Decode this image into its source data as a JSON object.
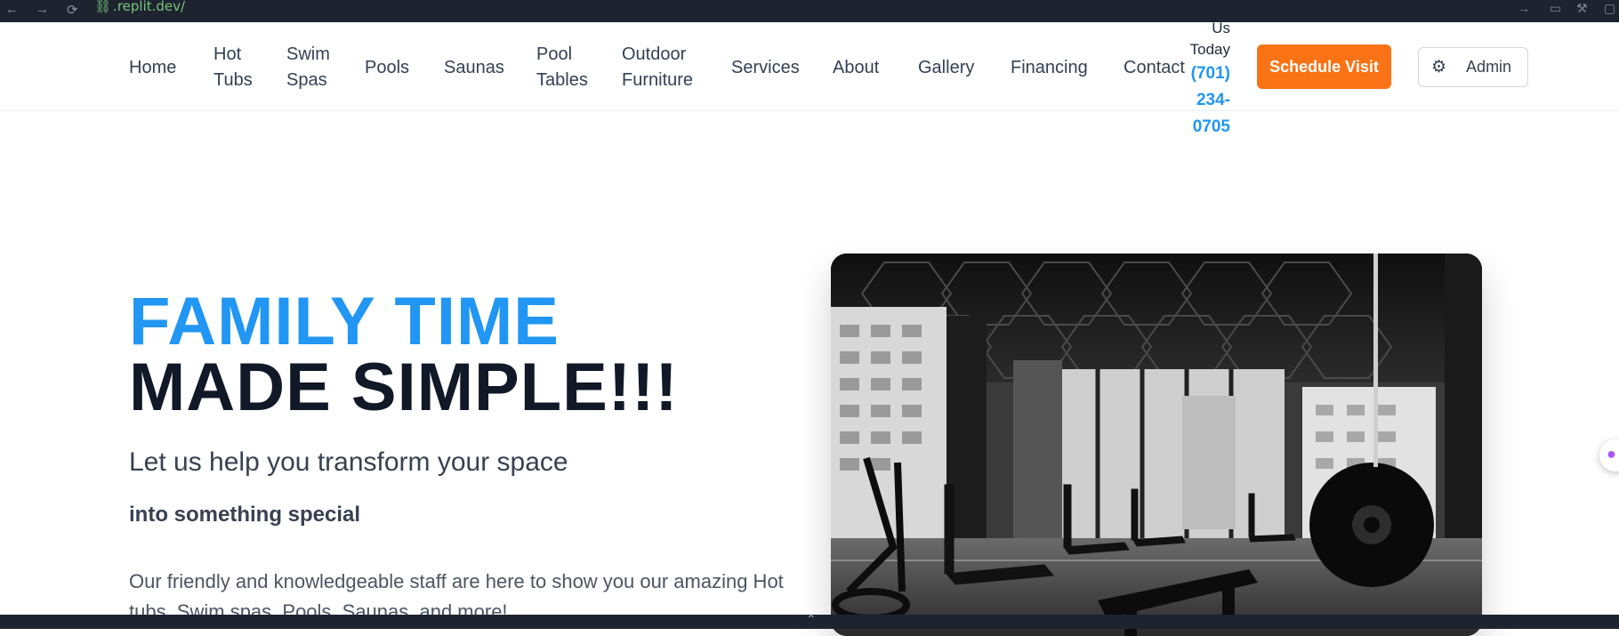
{
  "browser": {
    "url": ".replit.dev/",
    "back_icon": "←",
    "forward_icon": "→",
    "reload_icon": "⟳",
    "link_icon": "🔗"
  },
  "nav": {
    "links": [
      {
        "id": "home",
        "label": "Home"
      },
      {
        "id": "hot-tubs",
        "label_lines": [
          "Hot",
          "Tubs"
        ]
      },
      {
        "id": "swim-spas",
        "label_lines": [
          "Swim",
          "Spas"
        ]
      },
      {
        "id": "pools",
        "label": "Pools"
      },
      {
        "id": "saunas",
        "label": "Saunas"
      },
      {
        "id": "pool-tables",
        "label_lines": [
          "Pool",
          "Tables"
        ]
      },
      {
        "id": "outdoor-furniture",
        "label_lines": [
          "Outdoor",
          "Furniture"
        ]
      },
      {
        "id": "services",
        "label": "Services"
      },
      {
        "id": "about",
        "label": "About"
      },
      {
        "id": "gallery",
        "label": "Gallery"
      },
      {
        "id": "financing",
        "label": "Financing"
      },
      {
        "id": "contact",
        "label": "Contact"
      }
    ],
    "call_lines": [
      "Us",
      "Today"
    ],
    "phone_lines": [
      "(701)",
      "234-",
      "0705"
    ],
    "schedule_label": "Schedule Visit",
    "admin_label": "Admin"
  },
  "hero": {
    "title_line1": "FAMILY TIME",
    "title_line2": "MADE SIMPLE!!!",
    "subtitle": "Let us help you transform your space",
    "subtitle2": "into something special",
    "description": "Our friendly and knowledgeable staff are here to show you our amazing Hot tubs, Swim spas, Pools, Saunas, and more!"
  },
  "colors": {
    "accent_blue": "#2196f3",
    "cta_orange": "#f97316",
    "dark_text": "#111827"
  }
}
